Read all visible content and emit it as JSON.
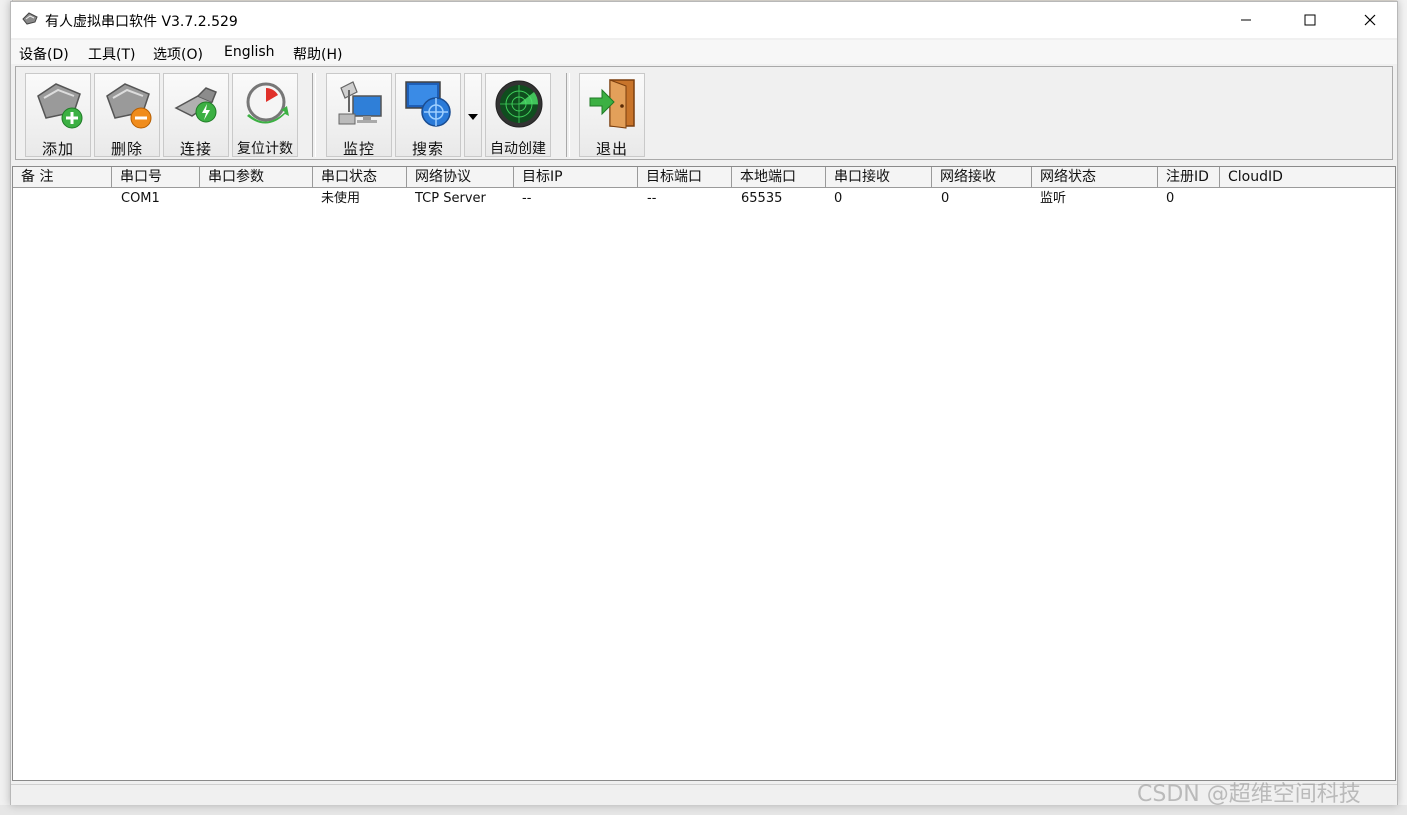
{
  "window": {
    "title": "有人虚拟串口软件 V3.7.2.529"
  },
  "menu": [
    {
      "label": "设备(D)"
    },
    {
      "label": "工具(T)"
    },
    {
      "label": "选项(O)"
    },
    {
      "label": "English"
    },
    {
      "label": "帮助(H)"
    }
  ],
  "toolbar": {
    "add_label": "添加",
    "delete_label": "删除",
    "connect_label": "连接",
    "reset_count_label": "复位计数",
    "monitor_label": "监控",
    "search_label": "搜索",
    "auto_create_label": "自动创建",
    "exit_label": "退出"
  },
  "table": {
    "columns": [
      "备 注",
      "串口号",
      "串口参数",
      "串口状态",
      "网络协议",
      "目标IP",
      "目标端口",
      "本地端口",
      "串口接收",
      "网络接收",
      "网络状态",
      "注册ID",
      "CloudID"
    ],
    "rows": [
      [
        "",
        "COM1",
        "",
        "未使用",
        "TCP Server",
        "--",
        "--",
        "65535",
        "0",
        "0",
        "监听",
        "0",
        ""
      ]
    ]
  },
  "watermark": "CSDN @超维空间科技",
  "colors": {
    "accent_green": "#3cb043",
    "accent_orange": "#f08c1c",
    "header_bg": "#f4f4f4"
  }
}
